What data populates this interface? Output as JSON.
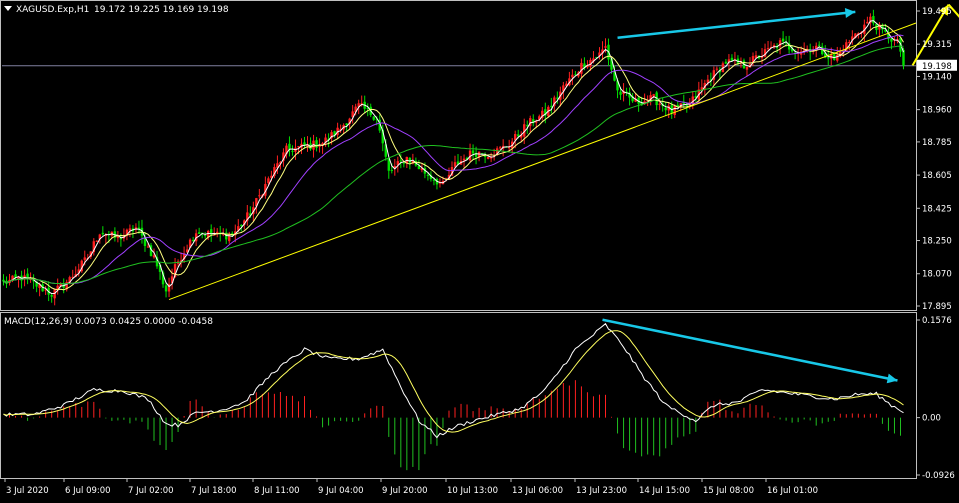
{
  "header": {
    "symbol": "XAGUSD.Exp,H1",
    "ohlc": "19.172 19.225 19.169 19.198",
    "macd_label": "MACD(12,26,9) 0.0073 0.0425 0.0000 -0.0458"
  },
  "colors": {
    "background": "#000000",
    "frame": "#c0c0c0",
    "bull_candle": "#ff2020",
    "bear_candle": "#00e000",
    "ma_fast": "#ffffff",
    "ma_mid": "#ffff80",
    "ma_slow": "#a040ff",
    "ma_long": "#20c020",
    "trendline": "#ffff00",
    "arrow_cyan": "#18c8e8",
    "arrow_yellow": "#ffff00",
    "price_line": "#8080a0",
    "hist_pos": "#ff2020",
    "hist_neg": "#20c020",
    "macd_line": "#ffffff",
    "signal_line": "#ffff60",
    "text": "#ffffff"
  },
  "chart_data": [
    {
      "type": "candlestick",
      "name": "main",
      "yticks": [
        "19.495",
        "19.315",
        "19.140",
        "18.960",
        "18.785",
        "18.605",
        "18.425",
        "18.250",
        "18.070",
        "17.895"
      ],
      "ylim": [
        17.895,
        19.495
      ],
      "current_price": "19.198",
      "xticks": [
        "3 Jul 2020",
        "6 Jul 09:00",
        "7 Jul 02:00",
        "7 Jul 18:00",
        "8 Jul 11:00",
        "9 Jul 04:00",
        "9 Jul 20:00",
        "10 Jul 13:00",
        "13 Jul 06:00",
        "13 Jul 23:00",
        "14 Jul 15:00",
        "15 Jul 08:00",
        "16 Jul 01:00"
      ],
      "anchors": [
        [
          0,
          18.02
        ],
        [
          6,
          18.05
        ],
        [
          12,
          18.0
        ],
        [
          16,
          17.96
        ],
        [
          22,
          18.04
        ],
        [
          28,
          18.16
        ],
        [
          32,
          18.3
        ],
        [
          38,
          18.26
        ],
        [
          44,
          18.32
        ],
        [
          50,
          18.16
        ],
        [
          54,
          17.98
        ],
        [
          58,
          18.14
        ],
        [
          64,
          18.3
        ],
        [
          70,
          18.28
        ],
        [
          76,
          18.28
        ],
        [
          82,
          18.4
        ],
        [
          88,
          18.58
        ],
        [
          94,
          18.74
        ],
        [
          100,
          18.76
        ],
        [
          106,
          18.78
        ],
        [
          112,
          18.86
        ],
        [
          118,
          18.98
        ],
        [
          124,
          18.92
        ],
        [
          128,
          18.62
        ],
        [
          134,
          18.7
        ],
        [
          140,
          18.62
        ],
        [
          146,
          18.55
        ],
        [
          150,
          18.66
        ],
        [
          156,
          18.73
        ],
        [
          162,
          18.72
        ],
        [
          168,
          18.77
        ],
        [
          174,
          18.88
        ],
        [
          180,
          18.94
        ],
        [
          186,
          19.08
        ],
        [
          192,
          19.2
        ],
        [
          198,
          19.26
        ],
        [
          200,
          19.3
        ],
        [
          204,
          19.06
        ],
        [
          210,
          19.0
        ],
        [
          216,
          19.02
        ],
        [
          222,
          18.95
        ],
        [
          228,
          18.99
        ],
        [
          234,
          19.12
        ],
        [
          240,
          19.22
        ],
        [
          246,
          19.2
        ],
        [
          252,
          19.26
        ],
        [
          258,
          19.32
        ],
        [
          264,
          19.28
        ],
        [
          270,
          19.3
        ],
        [
          276,
          19.23
        ],
        [
          282,
          19.35
        ],
        [
          288,
          19.45
        ],
        [
          292,
          19.38
        ],
        [
          297,
          19.32
        ],
        [
          300,
          19.198
        ]
      ],
      "moving_averages": [
        {
          "key": "ma_fast",
          "period": 3
        },
        {
          "key": "ma_mid",
          "period": 8
        },
        {
          "key": "ma_slow",
          "period": 21
        },
        {
          "key": "ma_long",
          "period": 55
        }
      ],
      "trendline": {
        "from": [
          55,
          17.93
        ],
        "to": [
          360,
          19.43
        ]
      },
      "cyan_arrow": {
        "from": [
          204,
          19.35
        ],
        "to": [
          283,
          19.49
        ]
      },
      "yellow_zigzag": [
        [
          302,
          19.2
        ],
        [
          314,
          19.53
        ],
        [
          321,
          19.4
        ],
        [
          337,
          19.53
        ]
      ]
    },
    {
      "type": "macd",
      "name": "macd",
      "yticks": [
        "0.1576",
        "0.00",
        "-0.0926"
      ],
      "ylim": [
        -0.0926,
        0.1576
      ],
      "anchors": [
        [
          0,
          0.005
        ],
        [
          10,
          0.005
        ],
        [
          20,
          0.02
        ],
        [
          30,
          0.045
        ],
        [
          40,
          0.043
        ],
        [
          48,
          0.03
        ],
        [
          54,
          -0.01
        ],
        [
          58,
          -0.012
        ],
        [
          64,
          0.008
        ],
        [
          72,
          0.012
        ],
        [
          80,
          0.025
        ],
        [
          90,
          0.075
        ],
        [
          100,
          0.11
        ],
        [
          108,
          0.095
        ],
        [
          118,
          0.095
        ],
        [
          126,
          0.11
        ],
        [
          132,
          0.05
        ],
        [
          138,
          -0.005
        ],
        [
          144,
          -0.03
        ],
        [
          150,
          -0.015
        ],
        [
          156,
          -0.005
        ],
        [
          164,
          0.005
        ],
        [
          172,
          0.015
        ],
        [
          180,
          0.045
        ],
        [
          190,
          0.11
        ],
        [
          200,
          0.15
        ],
        [
          206,
          0.115
        ],
        [
          212,
          0.07
        ],
        [
          220,
          0.02
        ],
        [
          230,
          -0.005
        ],
        [
          236,
          0.02
        ],
        [
          244,
          0.025
        ],
        [
          252,
          0.045
        ],
        [
          260,
          0.04
        ],
        [
          268,
          0.035
        ],
        [
          276,
          0.03
        ],
        [
          284,
          0.038
        ],
        [
          290,
          0.038
        ],
        [
          295,
          0.02
        ],
        [
          300,
          0.007
        ]
      ],
      "cyan_arrow": {
        "from": [
          199,
          0.158
        ],
        "to": [
          297,
          0.06
        ]
      }
    }
  ]
}
